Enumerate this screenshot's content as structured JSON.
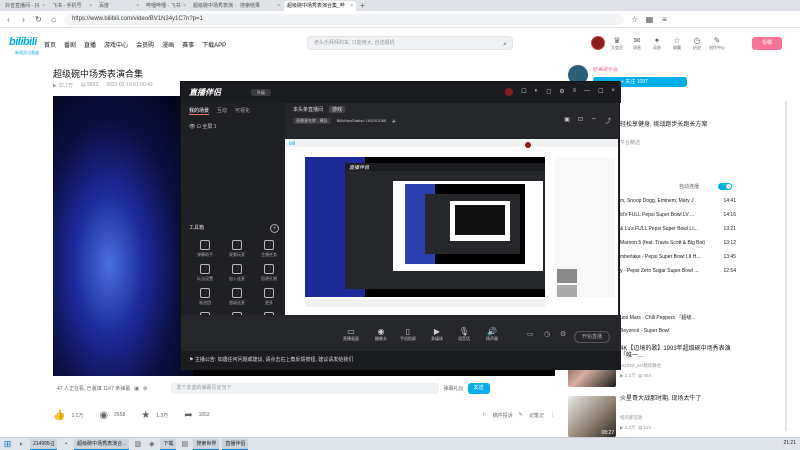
{
  "browser": {
    "tabs": [
      {
        "label": "抖音直播间 - 抖"
      },
      {
        "label": "飞书 - 手机号"
      },
      {
        "label": "百度"
      },
      {
        "label": "哔哩哔哩 - 飞书"
      },
      {
        "label": "超级碗中场秀表演"
      },
      {
        "label": "搜索结果"
      },
      {
        "label": "超级碗中场秀表演合集_哔"
      }
    ],
    "url": "https://www.bilibili.com/video/BV1N34y1C7n?p=1"
  },
  "site": {
    "logo": "bilibili",
    "logo_sub": "新闻资讯频道",
    "nav": [
      "首页",
      "番剧",
      "直播",
      "游戏中心",
      "会员购",
      "漫画",
      "赛事",
      "下载APP"
    ],
    "search_placeholder": "老头乐拜拜的车, 只能用大, 自选摄机",
    "header_icons": [
      {
        "icon": "vip-icon",
        "label": "大会员"
      },
      {
        "icon": "message-icon",
        "label": "消息"
      },
      {
        "icon": "dynamic-icon",
        "label": "动态"
      },
      {
        "icon": "favorite-icon",
        "label": "收藏"
      },
      {
        "icon": "history-icon",
        "label": "历史"
      },
      {
        "icon": "creator-icon",
        "label": "创作中心"
      }
    ],
    "upload_label": "投稿"
  },
  "video": {
    "title": "超级碗中场秀表演合集",
    "views": "32.7万",
    "danmaku": "5833",
    "date": "2022-02-16 01:00:42",
    "online": "47 人正在看, 已装填 1147 条弹幕",
    "danmaku_placeholder": "发个友善的弹幕见证当下",
    "danmaku_etiquette": "弹幕礼仪",
    "send_label": "发送",
    "likes": "1.1万",
    "coins": "2658",
    "collects": "1.3万",
    "shares": "1652",
    "report": "稿件投诉",
    "notes": "记笔记"
  },
  "uploader": {
    "name": "欧美歌手会",
    "follow": "+ 关注 1097"
  },
  "sidebar": {
    "top_rec": {
      "title": "轻松享健身, 挑战跑步长跑长方案",
      "meta": "平台精选"
    },
    "autoplay_label": "自动连播",
    "playlist": [
      {
        "title": "m, Snoop Dogg, Eminem, Mary J",
        "time": "14:41"
      },
      {
        "title": "ld's FULL Pepsi Super Bowl LV ...",
        "time": "14:16"
      },
      {
        "title": "& Lu's FULL Pepsi Super Bowl LI...",
        "time": "13:21"
      },
      {
        "title": "Maroon 5 (feat. Travis Scott & Big Boi)",
        "time": "13:12"
      },
      {
        "title": "mberlake - Pepsi Super Bowl LII H...",
        "time": "13:45"
      },
      {
        "title": "y - Pepsi Zero Sugar Super Bowl ...",
        "time": "12:54"
      },
      {
        "title": "uno Mars - Chili Peppers 『超级...",
        "time": ""
      },
      {
        "title": "Beyoncé - Super Bowl",
        "time": ""
      }
    ],
    "rec2": {
      "title": "4K【边境的歌】1993年超级碗中场秀表演「唯一...",
      "author": "MJJHD_MJ精修舞台",
      "views": "2.2万",
      "dm": "554"
    },
    "rec3": {
      "title": "火星哥大战那时期, 现场太牛了",
      "author": "橙的那首歌",
      "views": "4.2万",
      "dm": "123",
      "duration": "08:27"
    }
  },
  "obs": {
    "app_name": "直播伴侣",
    "version": "升级",
    "left_tabs": [
      "我的场景",
      "互动",
      "可视化"
    ],
    "scene": "全屏 1",
    "tools_title": "工具箱",
    "tools": [
      {
        "label": "弹幕助手"
      },
      {
        "label": "观看玩家"
      },
      {
        "label": "主播任务"
      },
      {
        "label": "玩法设置"
      },
      {
        "label": "加入连麦"
      },
      {
        "label": "搭建礼物"
      },
      {
        "label": "观战团"
      },
      {
        "label": "超级连麦"
      },
      {
        "label": "更多"
      },
      {
        "label": "录屏"
      },
      {
        "label": "截图"
      },
      {
        "label": "弹幕墙"
      }
    ],
    "right_tabs": [
      "本头条直播间",
      "游戏"
    ],
    "source_label": "直播源名称 - 横竖",
    "display_info": "BiliVideoStation 1920X1080",
    "bottom_items": [
      "直播画面",
      "摄像头",
      "手机投屏",
      "多媒体",
      "语音话",
      "扬声器"
    ],
    "start_live": "开始直播",
    "footer": "主播公告: 如遇任何问题或建议, 请点击右上角反馈按钮, 建议请发给我们"
  },
  "taskbar": {
    "apps": [
      "214995-[]",
      "超级碗中场秀表演合...",
      "下载",
      "搜索世界",
      "直播伴侣"
    ],
    "clock": "21:21"
  }
}
